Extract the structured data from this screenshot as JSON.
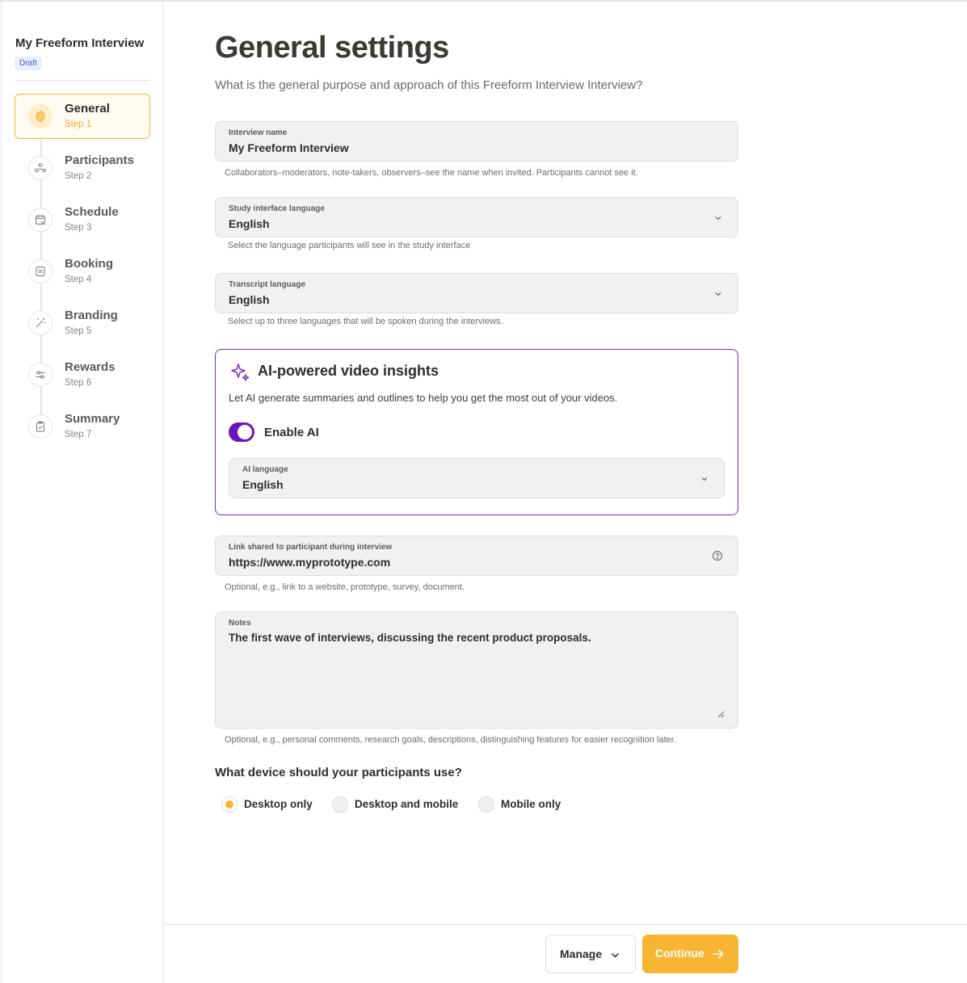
{
  "sidebar": {
    "study_title": "My Freeform Interview",
    "status_badge": "Draft",
    "steps": [
      {
        "label": "General",
        "num": "Step 1",
        "icon": "gear-icon"
      },
      {
        "label": "Participants",
        "num": "Step 2",
        "icon": "participants-icon"
      },
      {
        "label": "Schedule",
        "num": "Step 3",
        "icon": "calendar-icon"
      },
      {
        "label": "Booking",
        "num": "Step 4",
        "icon": "booking-icon"
      },
      {
        "label": "Branding",
        "num": "Step 5",
        "icon": "magic-wand-icon"
      },
      {
        "label": "Rewards",
        "num": "Step 6",
        "icon": "rewards-icon"
      },
      {
        "label": "Summary",
        "num": "Step 7",
        "icon": "clipboard-check-icon"
      }
    ]
  },
  "main": {
    "title": "General settings",
    "subtitle": "What is the general purpose and approach of this Freeform Interview Interview?",
    "interview_name": {
      "label": "Interview name",
      "value": "My Freeform Interview",
      "help": "Collaborators–moderators, note-takers, observers–see the name when invited. Participants cannot see it."
    },
    "interface_language": {
      "label": "Study interface language",
      "value": "English",
      "help": "Select the language participants will see in the study interface"
    },
    "transcript_language": {
      "label": "Transcript language",
      "value": "English",
      "help": "Select up to three languages that will be spoken during the interviews."
    },
    "ai": {
      "title": "AI-powered video insights",
      "description": "Let AI generate summaries and outlines to help you get the most out of your videos.",
      "toggle_label": "Enable AI",
      "language_label": "AI language",
      "language_value": "English"
    },
    "link": {
      "label": "Link shared to participant during interview",
      "value": "https://www.myprototype.com",
      "help": "Optional, e.g., link to a website, prototype, survey, document."
    },
    "notes": {
      "label": "Notes",
      "value": "The first wave of interviews, discussing the recent product proposals.",
      "help": "Optional, e.g., personal comments, research goals, descriptions, distinguishing features for easier recognition later."
    },
    "device": {
      "question": "What device should your participants use?",
      "options": [
        "Desktop only",
        "Desktop and mobile",
        "Mobile only"
      ],
      "selected": "Desktop only"
    }
  },
  "footer": {
    "manage_label": "Manage",
    "continue_label": "Continue"
  },
  "colors": {
    "accent": "#f8b533",
    "ai_purple": "#6b16b8",
    "draft_badge_bg": "#e8eefb",
    "draft_badge_text": "#3b66c9"
  }
}
